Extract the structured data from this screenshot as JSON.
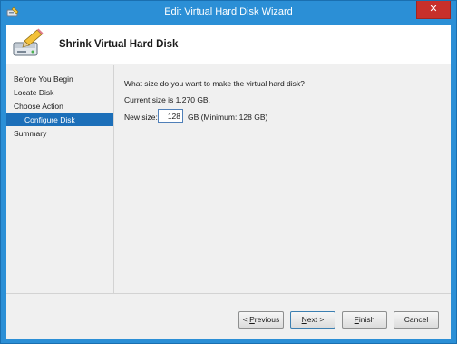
{
  "window": {
    "title": "Edit Virtual Hard Disk Wizard",
    "close_glyph": "✕"
  },
  "header": {
    "title": "Shrink Virtual Hard Disk",
    "icon": "disk-pencil-icon"
  },
  "steps": [
    {
      "label": "Before You Begin",
      "active": false
    },
    {
      "label": "Locate Disk",
      "active": false
    },
    {
      "label": "Choose Action",
      "active": false
    },
    {
      "label": "Configure Disk",
      "active": true
    },
    {
      "label": "Summary",
      "active": false
    }
  ],
  "content": {
    "question": "What size do you want to make the virtual hard disk?",
    "current_size": "Current size is 1,270 GB.",
    "new_size_label": "New size:",
    "new_size_value": "128",
    "new_size_unit": "GB (Minimum: 128 GB)"
  },
  "buttons": {
    "previous_prefix": "< ",
    "previous_mnemonic": "P",
    "previous_rest": "revious",
    "next_mnemonic": "N",
    "next_rest": "ext >",
    "finish_mnemonic": "F",
    "finish_rest": "inish",
    "cancel": "Cancel"
  },
  "colors": {
    "titlebar": "#2b8fd6",
    "active_step": "#1c6fb9",
    "close": "#c7302b"
  }
}
